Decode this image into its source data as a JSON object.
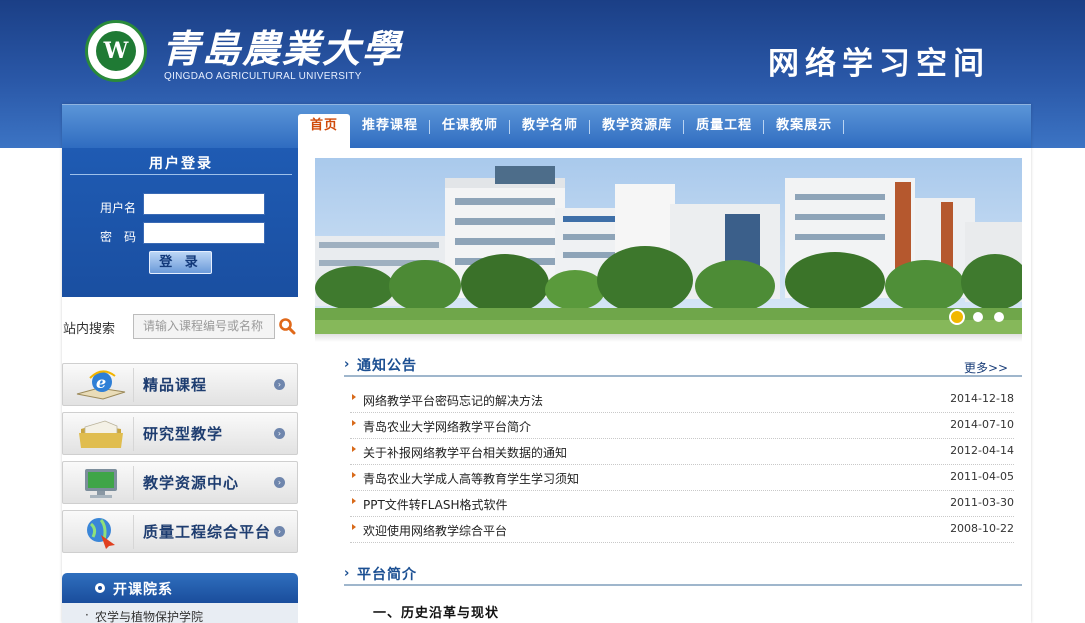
{
  "header": {
    "logo_text_cn": "青島農業大學",
    "logo_text_en": "QINGDAO AGRICULTURAL UNIVERSITY",
    "site_title": "网络学习空间",
    "colors": {
      "header_blue": "#2a58a8",
      "nav_active_text": "#d04a0a"
    }
  },
  "nav": {
    "items": [
      {
        "label": "首页",
        "active": true
      },
      {
        "label": "推荐课程"
      },
      {
        "label": "任课教师"
      },
      {
        "label": "教学名师"
      },
      {
        "label": "教学资源库"
      },
      {
        "label": "质量工程"
      },
      {
        "label": "教案展示"
      }
    ]
  },
  "login": {
    "title": "用户登录",
    "username_label": "用户名",
    "password_label": "密　码",
    "username_value": "",
    "password_value": "",
    "button_label": "登 录"
  },
  "search": {
    "label": "站内搜索",
    "placeholder": "请输入课程编号或名称",
    "icon": "search-icon"
  },
  "quicklinks": [
    {
      "label": "精品课程",
      "icon": "ie-book-icon"
    },
    {
      "label": "研究型教学",
      "icon": "folder-stack-icon"
    },
    {
      "label": "教学资源中心",
      "icon": "monitor-icon"
    },
    {
      "label": "质量工程综合平台",
      "icon": "globe-icon"
    }
  ],
  "departments": {
    "title": "开课院系",
    "items": [
      "农学与植物保护学院"
    ]
  },
  "banner": {
    "slide_count": 3,
    "active_slide": 1
  },
  "notices": {
    "title": "通知公告",
    "more_label": "更多>>",
    "items": [
      {
        "title": "网络教学平台密码忘记的解决方法",
        "date": "2014-12-18"
      },
      {
        "title": "青岛农业大学网络教学平台简介",
        "date": "2014-07-10"
      },
      {
        "title": "关于补报网络教学平台相关数据的通知",
        "date": "2012-04-14"
      },
      {
        "title": "青岛农业大学成人高等教育学生学习须知",
        "date": "2011-04-05"
      },
      {
        "title": "PPT文件转FLASH格式软件",
        "date": "2011-03-30"
      },
      {
        "title": "欢迎使用网络教学综合平台",
        "date": "2008-10-22"
      }
    ]
  },
  "intro": {
    "title": "平台简介",
    "subheading": "一、历史沿革与现状"
  }
}
